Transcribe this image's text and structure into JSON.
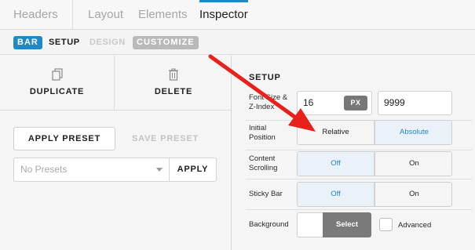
{
  "colors": {
    "accent": "#1e88c9",
    "arrow": "#e8221b",
    "select_btn": "#7a7a7a"
  },
  "top_tabs": [
    "Headers",
    "Layout",
    "Elements",
    "Inspector"
  ],
  "subbar": {
    "badge": "BAR",
    "setup": "SETUP",
    "design": "DESIGN",
    "customize": "CUSTOMIZE"
  },
  "left": {
    "duplicate": {
      "label": "DUPLICATE",
      "icon": "copy-icon"
    },
    "delete": {
      "label": "DELETE",
      "icon": "trash-icon"
    },
    "apply_preset": "APPLY PRESET",
    "save_preset": "SAVE PRESET",
    "presets_placeholder": "No Presets",
    "apply": "APPLY"
  },
  "right": {
    "title": "SETUP",
    "font_size_label_1": "Font Size &",
    "font_size_label_2": "Z-Index",
    "font_size": "16",
    "font_unit": "PX",
    "z_index": "9999",
    "position_label_1": "Initial",
    "position_label_2": "Position",
    "position_options": [
      "Relative",
      "Absolute"
    ],
    "position_selected": "Absolute",
    "scrolling_label_1": "Content",
    "scrolling_label_2": "Scrolling",
    "scrolling_options": [
      "Off",
      "On"
    ],
    "scrolling_selected": "Off",
    "sticky_label": "Sticky Bar",
    "sticky_options": [
      "Off",
      "On"
    ],
    "sticky_selected": "Off",
    "background_label": "Background",
    "background_select": "Select",
    "advanced_label": "Advanced",
    "advanced_checked": false
  }
}
